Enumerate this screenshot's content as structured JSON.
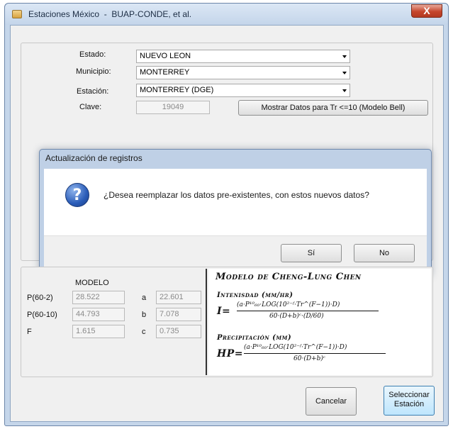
{
  "window": {
    "title": "Estaciones México  -  BUAP-CONDE, et al.",
    "close_label": "X"
  },
  "form": {
    "estado_label": "Estado:",
    "estado_value": "NUEVO LEON",
    "municipio_label": "Municipio:",
    "municipio_value": "MONTERREY",
    "estacion_label": "Estación:",
    "estacion_value": "MONTERREY (DGE)",
    "clave_label": "Clave:",
    "clave_value": "19049",
    "mostrar_button": "Mostrar Datos para Tr <=10 (Modelo Bell)"
  },
  "dialog": {
    "title": "Actualización de registros",
    "icon": "question-icon",
    "message": "¿Desea reemplazar los datos pre-existentes, con estos nuevos datos?",
    "yes_label": "Sí",
    "no_label": "No"
  },
  "model": {
    "heading": "MODELO",
    "p2_label": "P(60-2)",
    "p2_value": "28.522",
    "p10_label": "P(60-10)",
    "p10_value": "44.793",
    "f_label": "F",
    "f_value": "1.615",
    "a_label": "a",
    "a_value": "22.601",
    "b_label": "b",
    "b_value": "7.078",
    "c_label": "c",
    "c_value": "0.735"
  },
  "formula": {
    "title": "Modelo de Cheng-Lung Chen",
    "intensity_heading": "Intenisdad (mm/hr)",
    "i_symbol": "I=",
    "i_numerator": "(a·P¹⁰₆₀·LOG(10²⁻ᶠ·Tr^(F−1))·D)",
    "i_denominator": "60·(D+b)ᶜ·(D/60)",
    "precip_heading": "Precipitación (mm)",
    "hp_symbol": "HP=",
    "hp_numerator": "(a·P¹⁰₆₀·LOG(10²⁻ᶠ·Tr^(F−1))·D)",
    "hp_denominator": "60·(D+b)ᶜ"
  },
  "buttons": {
    "cancel_label": "Cancelar",
    "select_line1": "Seleccionar",
    "select_line2": "Estación"
  },
  "colors": {
    "accent": "#2a5cb8",
    "title_bar": "#c5d6ea",
    "close": "#c5452c"
  }
}
